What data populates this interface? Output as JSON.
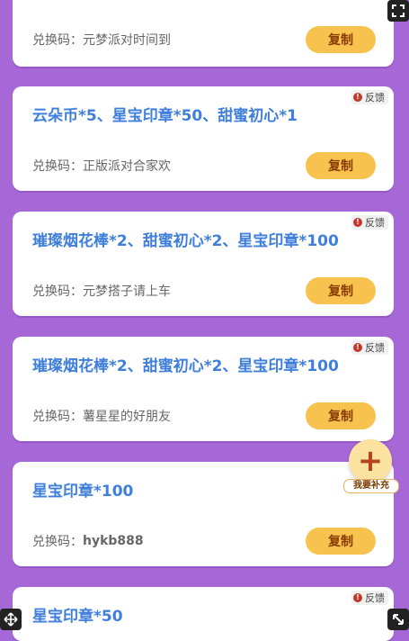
{
  "feedback_label": "反馈",
  "copy_label": "复制",
  "code_prefix": "兑换码：",
  "cards": [
    {
      "reward": "",
      "code": "元梦派对时间到",
      "has_feedback": false
    },
    {
      "reward": "云朵币*5、星宝印章*50、甜蜜初心*1",
      "code": "正版派对合家欢",
      "has_feedback": true
    },
    {
      "reward": "璀璨烟花棒*2、甜蜜初心*2、星宝印章*100",
      "code": "元梦搭子请上车",
      "has_feedback": true
    },
    {
      "reward": "璀璨烟花棒*2、甜蜜初心*2、星宝印章*100",
      "code": "薯星星的好朋友",
      "has_feedback": true
    },
    {
      "reward": "星宝印章*100",
      "code": "hykb888",
      "has_feedback": false
    },
    {
      "reward": "星宝印章*50",
      "code": "",
      "has_feedback": true
    }
  ],
  "add_button": {
    "label": "我要补充"
  },
  "icons": {
    "expand": "expand-icon",
    "move": "move-icon",
    "fullscreen": "fullscreen-icon",
    "add": "plus-icon",
    "feedback": "alert-icon"
  },
  "colors": {
    "background": "#a668d6",
    "reward_text": "#3f7fdb",
    "copy_button": "#f7c34e"
  }
}
